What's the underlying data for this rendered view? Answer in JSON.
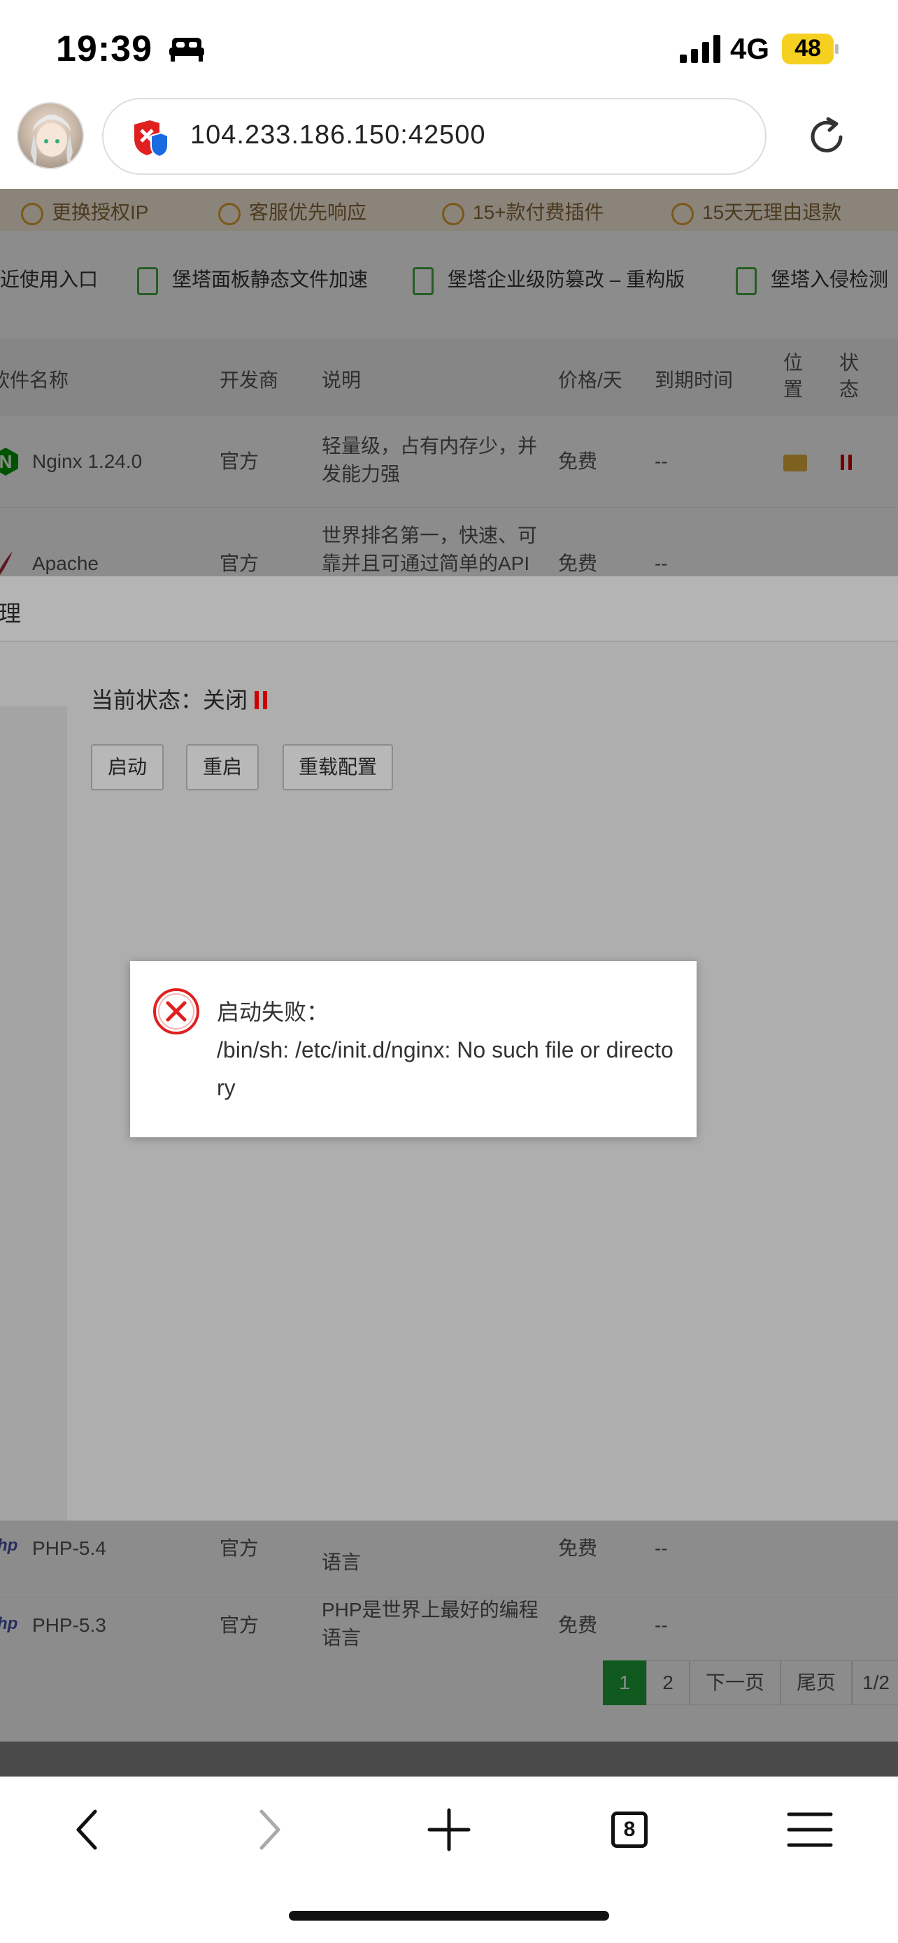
{
  "status_bar": {
    "time": "19:39",
    "network": "4G",
    "battery": "48",
    "icons": [
      "bed-icon",
      "signal-icon",
      "battery-icon"
    ]
  },
  "browser": {
    "url": "104.233.186.150:42500",
    "icons": [
      "avatar",
      "shield-icon",
      "reload-icon"
    ]
  },
  "promo": {
    "items": [
      "更换授权IP",
      "客服优先响应",
      "15+款付费插件",
      "15天无理由退款"
    ]
  },
  "recommended_plugins": {
    "items": [
      "近使用入口",
      "堡塔面板静态文件加速",
      "堡塔企业级防篡改 – 重构版",
      "堡塔入侵检测"
    ]
  },
  "software_table": {
    "headers": {
      "name": "软件名称",
      "developer": "开发商",
      "description": "说明",
      "price": "价格/天",
      "expire": "到期时间",
      "location": "位置",
      "status": "状态"
    },
    "rows": [
      {
        "name": "Nginx 1.24.0",
        "developer": "官方",
        "description": "轻量级，占有内存少，并发能力强",
        "price": "免费",
        "expire": "--"
      },
      {
        "name": "Apache",
        "developer": "官方",
        "description": "世界排名第一，快速、可靠并且可通过简单的API扩充",
        "price": "免费",
        "expire": "--"
      },
      {
        "name": "PHP-5.4",
        "developer": "官方",
        "description": "语言",
        "price": "免费",
        "expire": "--"
      },
      {
        "name": "PHP-5.3",
        "developer": "官方",
        "description": "PHP是世界上最好的编程语言",
        "price": "免费",
        "expire": "--"
      }
    ],
    "php_logo": "hp"
  },
  "pagination": {
    "current": "1",
    "page2": "2",
    "next": "下一页",
    "last": "尾页",
    "count": "1/2"
  },
  "panel": {
    "title": "理",
    "status_label": "当前状态：",
    "status_value": "关闭",
    "buttons": {
      "start": "启动",
      "restart": "重启",
      "reload": "重载配置"
    }
  },
  "dialog": {
    "title": "启动失败：",
    "message": "/bin/sh: /etc/init.d/nginx: No such file or directory"
  },
  "toolbar": {
    "tab_count": "8",
    "icons": [
      "back-icon",
      "forward-icon",
      "new-tab-icon",
      "tabs-icon",
      "menu-icon"
    ]
  },
  "colors": {
    "accent_green": "#20a53a",
    "error_red": "#e02020",
    "battery_yellow": "#f5d020"
  }
}
